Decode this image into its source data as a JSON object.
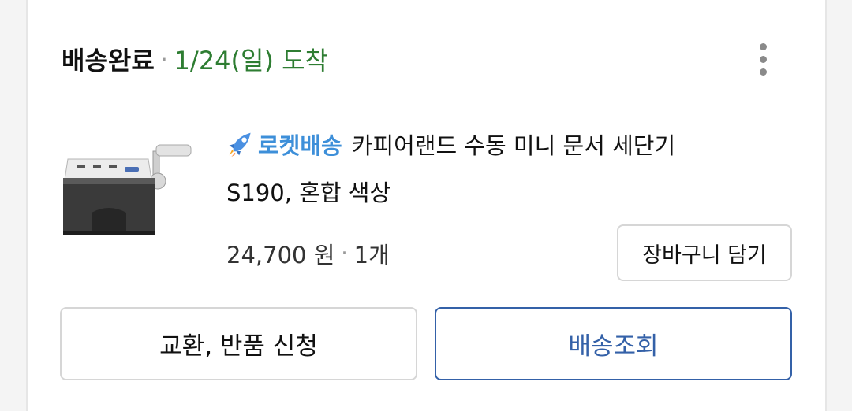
{
  "order": {
    "status": "배송완료",
    "separator": "·",
    "arrival": "1/24(일) 도착"
  },
  "product": {
    "badge_icon": "rocket-icon",
    "badge_label": "로켓배송",
    "name_line1": "카피어랜드 수동 미니 문서 세단기",
    "name_line2": "S190, 혼합 색상",
    "price": "24,700 원",
    "separator": "·",
    "quantity": "1개"
  },
  "buttons": {
    "add_to_cart": "장바구니 담기",
    "exchange_return": "교환, 반품 신청",
    "track_delivery": "배송조회"
  },
  "menu": {
    "icon": "more-vertical-icon"
  },
  "colors": {
    "arrival_green": "#2e7d32",
    "rocket_blue": "#3d8fd9",
    "tracking_blue": "#3461a8"
  }
}
